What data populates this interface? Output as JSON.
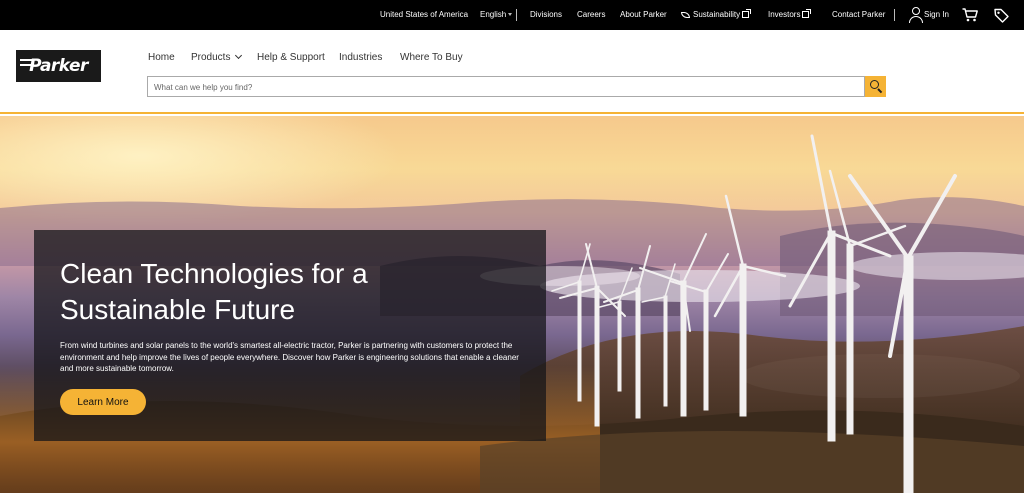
{
  "topbar": {
    "country": "United States of America",
    "language": "English",
    "links": {
      "divisions": "Divisions",
      "careers": "Careers",
      "about": "About Parker",
      "sustainability": "Sustainability",
      "investors": "Investors",
      "contact": "Contact Parker",
      "sign_in": "Sign In"
    },
    "icons": [
      "leaf-icon",
      "external-link-icon",
      "user-icon",
      "cart-icon",
      "tag-icon"
    ]
  },
  "header": {
    "logo_text": "Parker",
    "nav": {
      "home": "Home",
      "products": "Products",
      "help": "Help & Support",
      "industries": "Industries",
      "where_to_buy": "Where To Buy"
    },
    "search": {
      "placeholder": "What can we help you find?",
      "value": ""
    }
  },
  "hero": {
    "title": "Clean Technologies for a Sustainable Future",
    "body": "From wind turbines and solar panels to the world's smartest all-electric tractor, Parker is partnering with customers to protect the environment and help improve the lives of people everywhere. Discover how Parker is engineering solutions that enable a cleaner and more sustainable tomorrow.",
    "cta": "Learn More"
  },
  "colors": {
    "accent": "#f5b335",
    "topbar_bg": "#000000",
    "panel_bg": "#141418"
  }
}
